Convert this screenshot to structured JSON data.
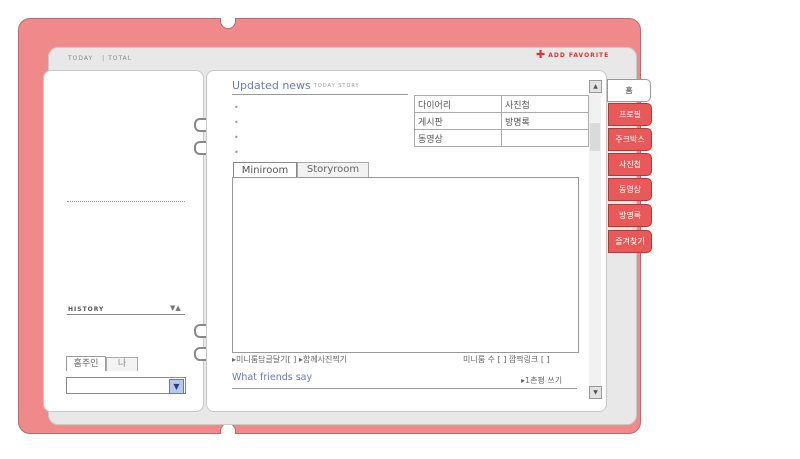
{
  "header": {
    "today_label": "TODAY",
    "total_label": "| TOTAL",
    "add_favorite": "ADD FAVORITE"
  },
  "left": {
    "history_label": "HISTORY",
    "history_arrows": "▼▲",
    "tabs": [
      "홈주인",
      "나"
    ]
  },
  "news": {
    "title": "Updated news",
    "subtitle": "TODAY STORY"
  },
  "menu_table": [
    [
      "다이어리",
      "사진첩"
    ],
    [
      "게시판",
      "방명록"
    ],
    [
      "동영상",
      ""
    ]
  ],
  "miniroom": {
    "tabs": [
      "Miniroom",
      "Storyroom"
    ],
    "footer_left": "▸미니룸담글달기[   ] ▸함께사진찍기",
    "footer_right": "미니룸 수 [   ]   깜짝링크 [  ]"
  },
  "friends": {
    "title": "What friends say",
    "write_label": "▸1촌평 쓰기"
  },
  "side_tabs": {
    "home": "홈",
    "items": [
      "프로필",
      "주크박스",
      "사진첩",
      "동영상",
      "방명록",
      "즐겨찾기"
    ]
  },
  "colors": {
    "binder": "#f08a8a",
    "tab_red": "#e85a5a",
    "link_blue": "#6b78b8"
  }
}
